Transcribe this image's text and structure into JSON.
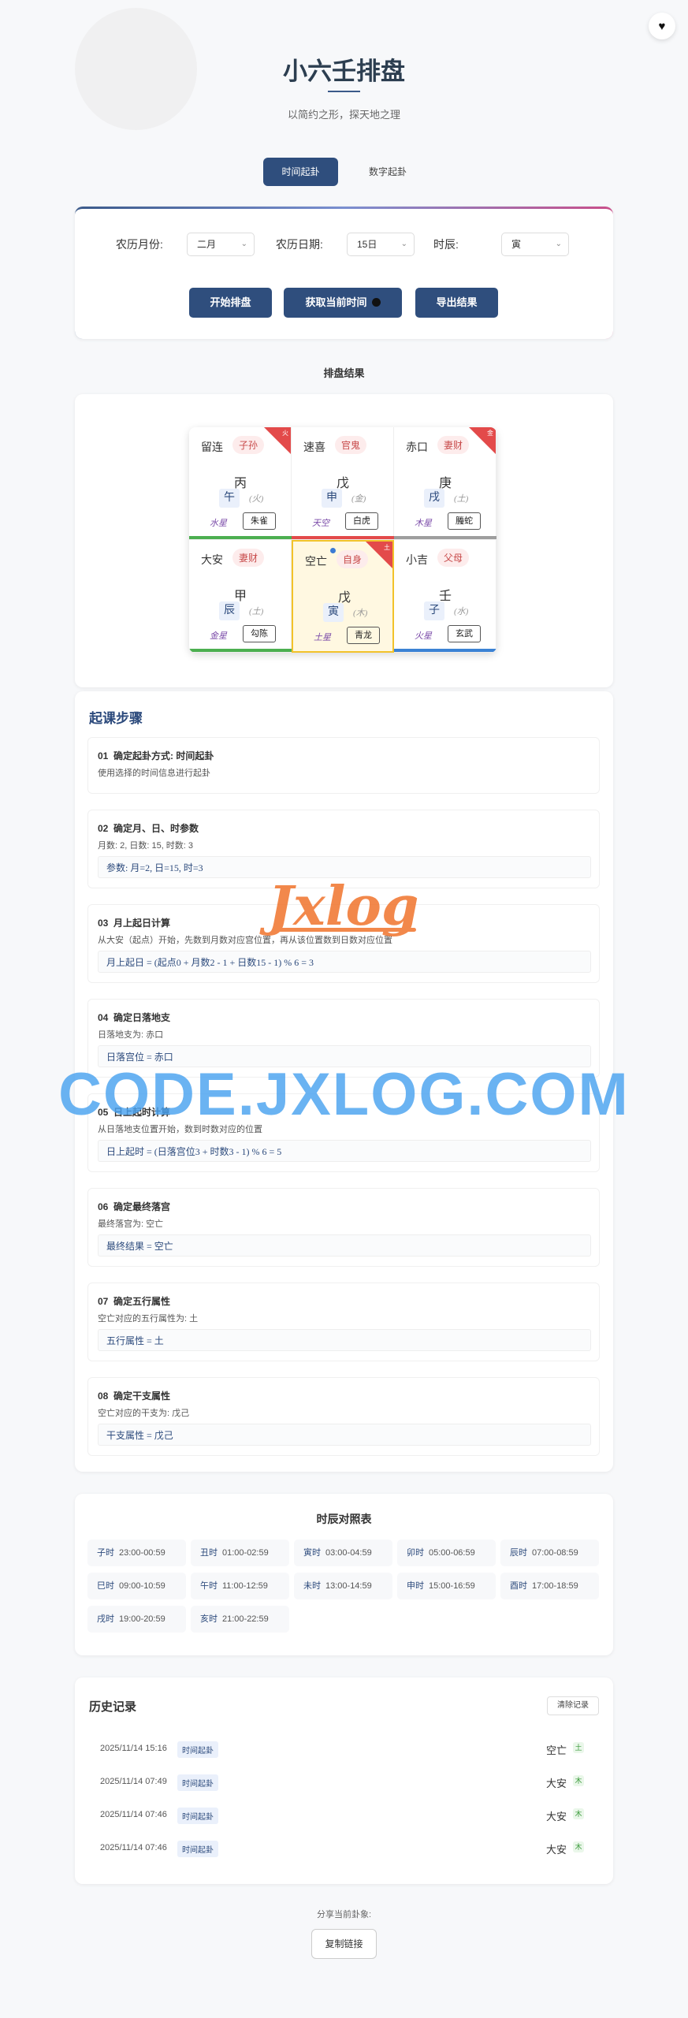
{
  "header": {
    "title": "小六壬排盘",
    "subtitle": "以简约之形，探天地之理"
  },
  "icons": {
    "favorite": "heart-icon",
    "record": "circle-dot-icon"
  },
  "tabs": [
    {
      "label": "时间起卦",
      "active": true
    },
    {
      "label": "数字起卦",
      "active": false
    }
  ],
  "form": {
    "month_label": "农历月份:",
    "month_value": "二月",
    "day_label": "农历日期:",
    "day_value": "15日",
    "hour_label": "时辰:",
    "hour_value": "寅",
    "start_button": "开始排盘",
    "now_button": "获取当前时间",
    "export_button": "导出结果"
  },
  "result_label": "排盘结果",
  "board": [
    {
      "name": "留连",
      "rel": "子孙",
      "stem": "丙",
      "branch": "午",
      "element": "(火)",
      "star": "水星",
      "god": "朱雀",
      "corner": "火",
      "bar": "#4caf50"
    },
    {
      "name": "速喜",
      "rel": "官鬼",
      "stem": "戊",
      "branch": "申",
      "element": "(金)",
      "star": "天空",
      "god": "白虎",
      "corner": "",
      "bar": "#e34a4a"
    },
    {
      "name": "赤口",
      "rel": "妻财",
      "stem": "庚",
      "branch": "戌",
      "element": "(土)",
      "star": "木星",
      "god": "螣蛇",
      "corner": "金",
      "bar": "#9e9e9e"
    },
    {
      "name": "大安",
      "rel": "妻财",
      "stem": "甲",
      "branch": "辰",
      "element": "(土)",
      "star": "金星",
      "god": "勾陈",
      "corner": "",
      "bar": "#4caf50"
    },
    {
      "name": "空亡",
      "rel": "自身",
      "stem": "戊",
      "branch": "寅",
      "element": "(木)",
      "star": "土星",
      "god": "青龙",
      "corner": "土",
      "bar": ""
    },
    {
      "name": "小吉",
      "rel": "父母",
      "stem": "壬",
      "branch": "子",
      "element": "(水)",
      "star": "火星",
      "god": "玄武",
      "corner": "",
      "bar": "#3b82d4"
    }
  ],
  "steps": {
    "title": "起课步骤",
    "items": [
      {
        "num": "01",
        "title": "确定起卦方式: 时间起卦",
        "desc": "使用选择的时间信息进行起卦",
        "formula": ""
      },
      {
        "num": "02",
        "title": "确定月、日、时参数",
        "desc": "月数: 2, 日数: 15, 时数: 3",
        "formula": "参数: 月=2, 日=15, 时=3"
      },
      {
        "num": "03",
        "title": "月上起日计算",
        "desc": "从大安（起点）开始，先数到月数对应宫位置，再从该位置数到日数对应位置",
        "formula": "月上起日 = (起点0 + 月数2 - 1 + 日数15 - 1) % 6 = 3"
      },
      {
        "num": "04",
        "title": "确定日落地支",
        "desc": "日落地支为: 赤口",
        "formula": "日落宫位 = 赤口"
      },
      {
        "num": "05",
        "title": "日上起时计算",
        "desc": "从日落地支位置开始，数到时数对应的位置",
        "formula": "日上起时 = (日落宫位3 + 时数3 - 1) % 6 = 5"
      },
      {
        "num": "06",
        "title": "确定最终落宫",
        "desc": "最终落宫为: 空亡",
        "formula": "最终结果 = 空亡"
      },
      {
        "num": "07",
        "title": "确定五行属性",
        "desc": "空亡对应的五行属性为: 土",
        "formula": "五行属性 = 土"
      },
      {
        "num": "08",
        "title": "确定干支属性",
        "desc": "空亡对应的干支为: 戊己",
        "formula": "干支属性 = 戊己"
      }
    ]
  },
  "watermark": {
    "logo": "Jxlog",
    "text": "CODE.JXLOG.COM"
  },
  "shichen": {
    "title": "时辰对照表",
    "items": [
      {
        "name": "子时",
        "time": "23:00-00:59"
      },
      {
        "name": "丑时",
        "time": "01:00-02:59"
      },
      {
        "name": "寅时",
        "time": "03:00-04:59"
      },
      {
        "name": "卯时",
        "time": "05:00-06:59"
      },
      {
        "name": "辰时",
        "time": "07:00-08:59"
      },
      {
        "name": "巳时",
        "time": "09:00-10:59"
      },
      {
        "name": "午时",
        "time": "11:00-12:59"
      },
      {
        "name": "未时",
        "time": "13:00-14:59"
      },
      {
        "name": "申时",
        "time": "15:00-16:59"
      },
      {
        "name": "酉时",
        "time": "17:00-18:59"
      },
      {
        "name": "戌时",
        "time": "19:00-20:59"
      },
      {
        "name": "亥时",
        "time": "21:00-22:59"
      }
    ]
  },
  "history": {
    "title": "历史记录",
    "clear_button": "清除记录",
    "rows": [
      {
        "time": "2025/11/14 15:16",
        "method": "时间起卦",
        "result": "空亡",
        "element": "土"
      },
      {
        "time": "2025/11/14 07:49",
        "method": "时间起卦",
        "result": "大安",
        "element": "木"
      },
      {
        "time": "2025/11/14 07:46",
        "method": "时间起卦",
        "result": "大安",
        "element": "木"
      },
      {
        "time": "2025/11/14 07:46",
        "method": "时间起卦",
        "result": "大安",
        "element": "木"
      }
    ]
  },
  "share": {
    "label": "分享当前卦象:",
    "copy_button": "复制链接"
  }
}
